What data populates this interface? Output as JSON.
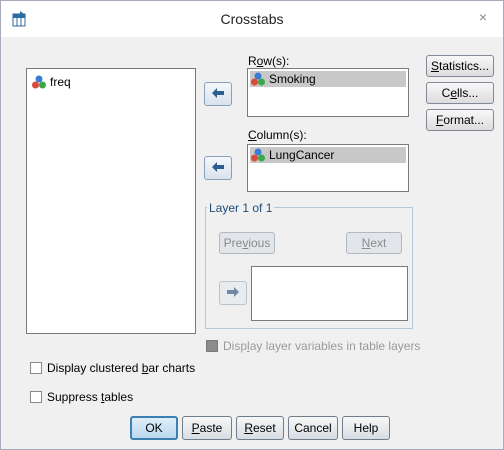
{
  "window": {
    "title": "Crosstabs",
    "close_glyph": "×"
  },
  "source_list": {
    "items": [
      {
        "label": "freq",
        "icon": "nominal-icon"
      }
    ]
  },
  "rows": {
    "label_pre": "R",
    "label_u": "o",
    "label_post": "w(s):",
    "items": [
      {
        "label": "Smoking",
        "icon": "nominal-icon"
      }
    ]
  },
  "columns": {
    "label_pre": "",
    "label_u": "C",
    "label_post": "olumn(s):",
    "items": [
      {
        "label": "LungCancer",
        "icon": "nominal-icon"
      }
    ]
  },
  "side_buttons": {
    "statistics": {
      "u": "S",
      "rest": "tatistics..."
    },
    "cells": {
      "pre": "C",
      "u": "e",
      "rest": "lls..."
    },
    "format": {
      "u": "F",
      "rest": "ormat..."
    }
  },
  "layer": {
    "title": "Layer 1 of 1",
    "previous": {
      "pre": "Pre",
      "u": "v",
      "rest": "ious"
    },
    "next": {
      "u": "N",
      "rest": "ext"
    }
  },
  "checks": {
    "display_layer": {
      "pre": "Disp",
      "u": "l",
      "rest": "ay layer variables in table layers",
      "checked": false,
      "enabled": false
    },
    "clustered_bar": {
      "pre": "Display clustered ",
      "u": "b",
      "rest": "ar charts",
      "checked": false
    },
    "suppress": {
      "pre": "Suppress ",
      "u": "t",
      "rest": "ables",
      "checked": false
    }
  },
  "buttons": {
    "ok": "OK",
    "paste": {
      "u": "P",
      "rest": "aste"
    },
    "reset": {
      "u": "R",
      "rest": "eset"
    },
    "cancel": "Cancel",
    "help": "Help"
  },
  "colors": {
    "accent": "#3c7fb1",
    "arrow": "#2b5f8f",
    "selected_bg": "#c8c8c8"
  }
}
